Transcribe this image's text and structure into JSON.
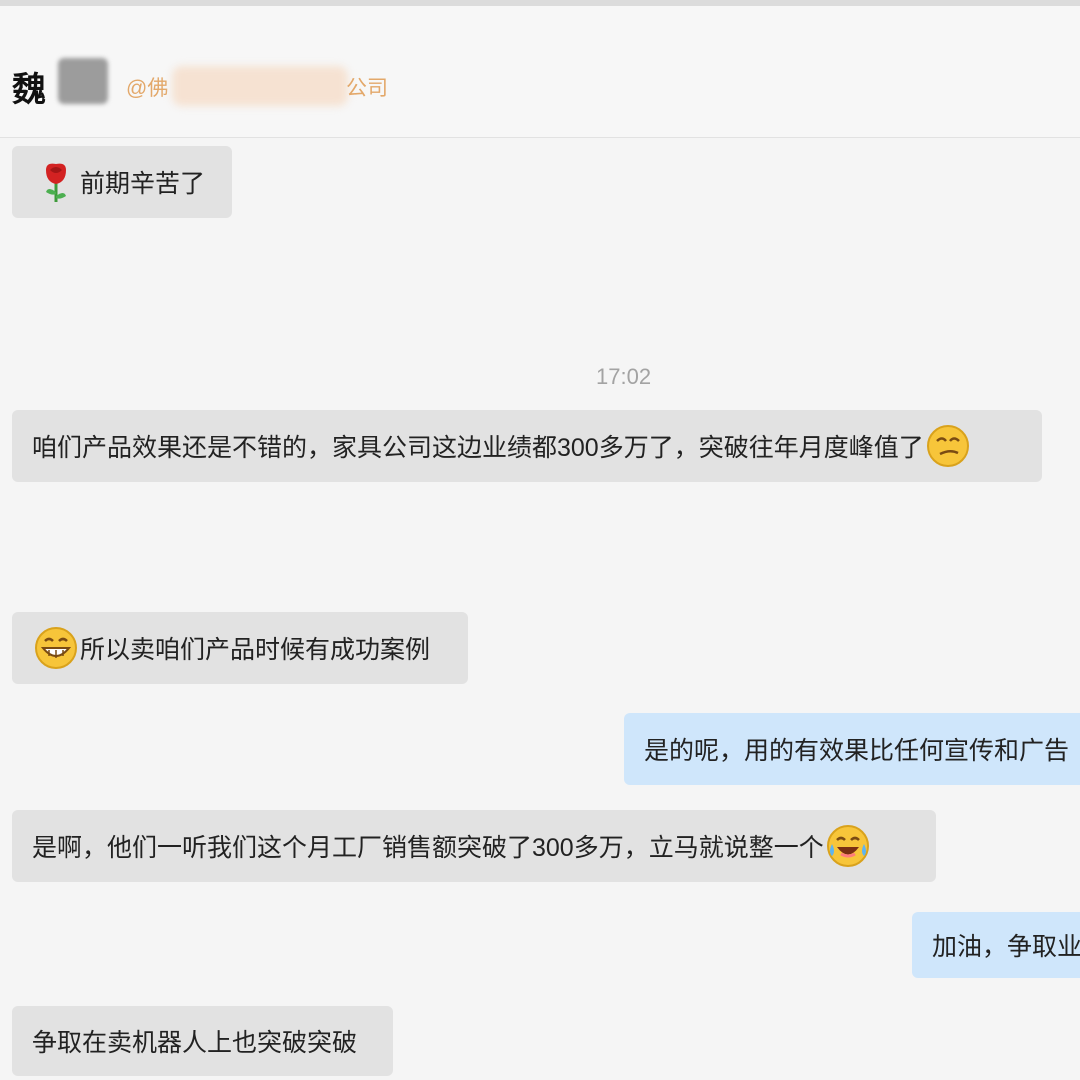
{
  "header": {
    "name_visible": "魏",
    "org_prefix": "@佛",
    "org_suffix": "公司"
  },
  "timestamp": "17:02",
  "messages": [
    {
      "text": "前期辛苦了",
      "icon": "rose-icon"
    },
    {
      "text": "咱们产品效果还是不错的，家具公司这边业绩都300多万了，突破往年月度峰值了",
      "icon": "smirk-icon"
    },
    {
      "text": "所以卖咱们产品时候有成功案例",
      "icon": "grin-icon"
    },
    {
      "text": "是的呢，用的有效果比任何宣传和广告"
    },
    {
      "text": "是啊，他们一听我们这个月工厂销售额突破了300多万，立马就说整一个",
      "icon": "laugh-cry-icon"
    },
    {
      "text": "加油，争取业"
    },
    {
      "text": "争取在卖机器人上也突破突破"
    }
  ],
  "colors": {
    "incoming_bubble": "#e2e2e2",
    "outgoing_bubble": "#cfe6fb",
    "org_text": "#e3a86a"
  }
}
